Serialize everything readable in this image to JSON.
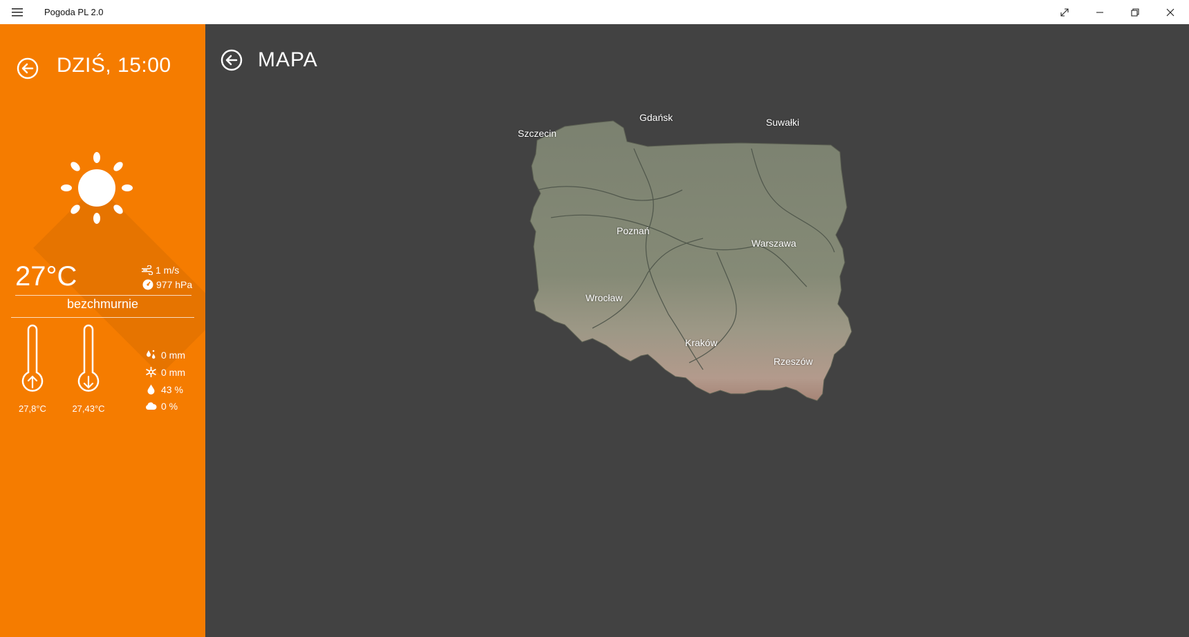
{
  "window": {
    "title": "Pogoda PL 2.0"
  },
  "sidebar": {
    "title": "DZIŚ, 15:00",
    "weather_icon": "sun-icon",
    "temperature": "27°C",
    "wind": "1 m/s",
    "pressure": "977 hPa",
    "description": "bezchmurnie",
    "temp_max": "27,8°C",
    "temp_min": "27,43°C",
    "rain": "0 mm",
    "snow": "0 mm",
    "humidity": "43 %",
    "cloudiness": "0 %"
  },
  "main": {
    "title": "MAPA",
    "map": {
      "cities": [
        "Szczecin",
        "Gdańsk",
        "Suwałki",
        "Poznań",
        "Warszawa",
        "Wrocław",
        "Kraków",
        "Rzeszów"
      ]
    }
  },
  "colors": {
    "sidebar": "#f57c00",
    "main_bg": "#424242",
    "terrain": "#7f8571",
    "mountains": "#b9998a"
  }
}
